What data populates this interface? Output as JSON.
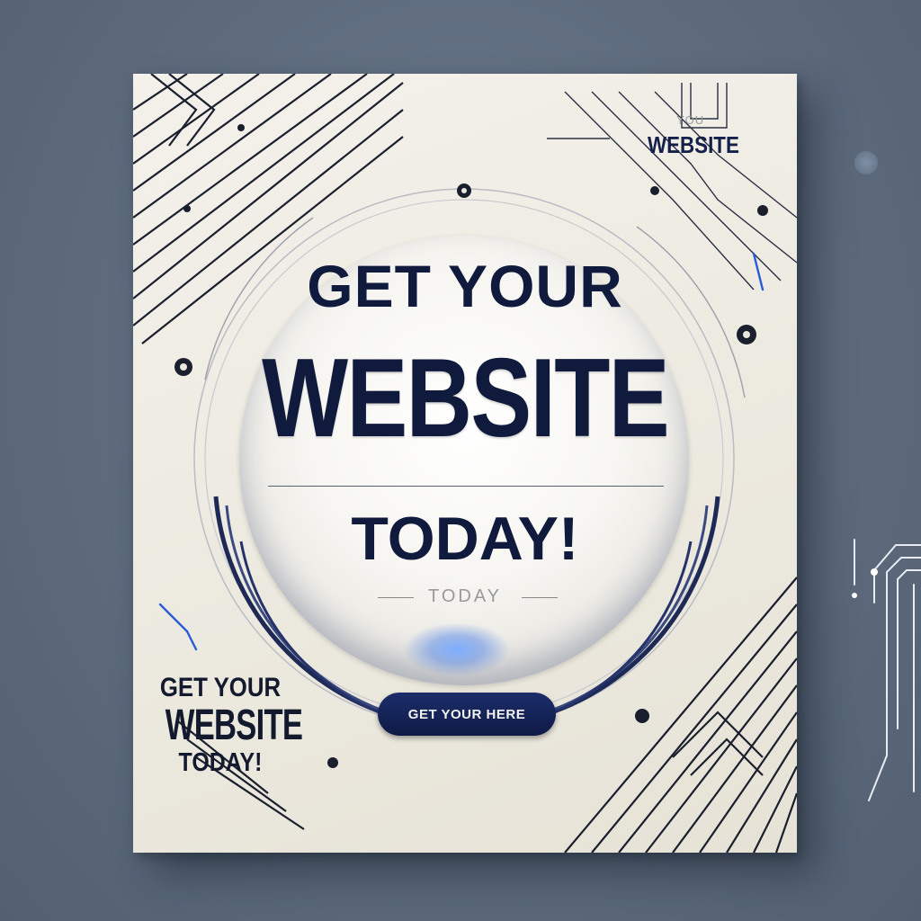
{
  "poster": {
    "headline": {
      "line1": "GET YOUR",
      "line2": "WEBSITE",
      "line3": "TODAY!"
    },
    "sub_label": "TODAY",
    "corner_label": "WEBSITE",
    "corner_faint": "YOU",
    "cta_label": "GET YOUR HERE",
    "small_block": {
      "line1": "GET YOUR",
      "line2": "WEBSITE",
      "line3": "TODAY!"
    }
  },
  "colors": {
    "navy": "#0f1a3c",
    "accent_blue": "#2a5bd7",
    "paper": "#f3f1ea",
    "background": "#5d6b7d"
  }
}
